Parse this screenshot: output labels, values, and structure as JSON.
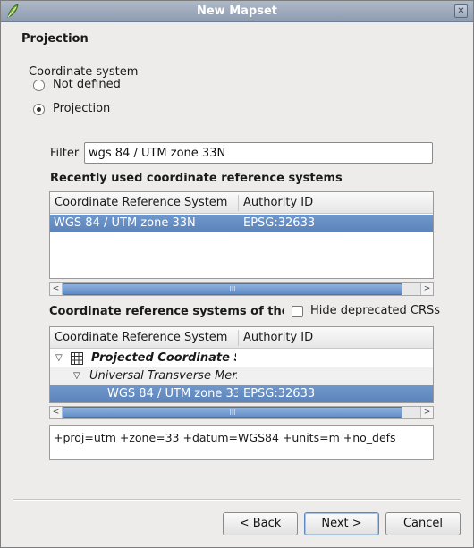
{
  "window": {
    "title": "New Mapset",
    "close_symbol": "✕"
  },
  "page": {
    "heading": "Projection"
  },
  "coordinate_system": {
    "label": "Coordinate system",
    "options": [
      {
        "label": "Not defined",
        "checked": false
      },
      {
        "label": "Projection",
        "checked": true
      }
    ]
  },
  "filter": {
    "label": "Filter",
    "value": "wgs 84 / UTM zone 33N"
  },
  "recent": {
    "title": "Recently used coordinate reference systems",
    "columns": [
      "Coordinate Reference System",
      "Authority ID"
    ],
    "rows": [
      {
        "crs": "WGS 84 / UTM zone 33N",
        "authority": "EPSG:32633",
        "selected": true
      }
    ]
  },
  "world": {
    "title": "Coordinate reference systems of the wor",
    "hide_deprecated_label": "Hide deprecated CRSs",
    "hide_deprecated_checked": false,
    "columns": [
      "Coordinate Reference System",
      "Authority ID"
    ],
    "tree": [
      {
        "label": "Projected Coordinate S...",
        "authority": "",
        "level": 0
      },
      {
        "label": "Universal Transverse Mer...",
        "authority": "",
        "level": 1
      },
      {
        "label": "WGS 84 / UTM zone 33N",
        "authority": "EPSG:32633",
        "level": 2,
        "selected": true
      }
    ]
  },
  "proj_string": "+proj=utm +zone=33 +datum=WGS84 +units=m +no_defs",
  "buttons": {
    "back": "< Back",
    "next": "Next >",
    "cancel": "Cancel"
  },
  "scroll": {
    "left_arrow": "<",
    "right_arrow": ">",
    "grip": "III"
  },
  "colors": {
    "selection": "#5b84bb",
    "titlebar": "#8e9cb1"
  }
}
